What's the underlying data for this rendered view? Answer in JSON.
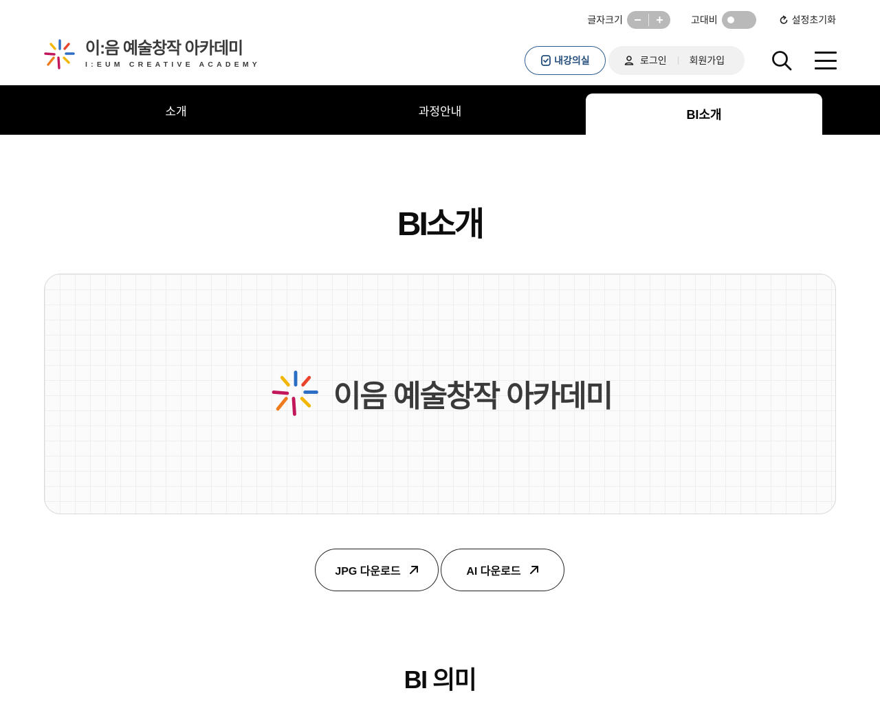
{
  "utility": {
    "font_size_label": "글자크기",
    "font_decrease": "−",
    "font_increase": "+",
    "contrast_label": "고대비",
    "reset_label": "설정초기화"
  },
  "header": {
    "logo_title": "이:음 예술창작 아카데미",
    "logo_subtitle": "I:EUM CREATIVE ACADEMY",
    "my_class_label": "내강의실",
    "login_label": "로그인",
    "signup_label": "회원가입"
  },
  "nav": {
    "tabs": [
      {
        "label": "소개",
        "active": false
      },
      {
        "label": "과정안내",
        "active": false
      },
      {
        "label": "BI소개",
        "active": true
      }
    ]
  },
  "main": {
    "page_title": "BI소개",
    "bi_logo_text": "이음 예술창작 아카데미",
    "downloads": [
      {
        "label": "JPG 다운로드"
      },
      {
        "label": "AI 다운로드"
      }
    ],
    "section_title": "BI 의미"
  },
  "colors": {
    "accent_navy": "#244e7c",
    "nav_bg": "#000000",
    "logo_text": "#3a3a3a",
    "ray_yellow": "#f2b705",
    "ray_red": "#e8452c",
    "ray_blue": "#2b6cc4",
    "ray_magenta": "#c2185b",
    "ray_orange": "#f07b1d"
  }
}
